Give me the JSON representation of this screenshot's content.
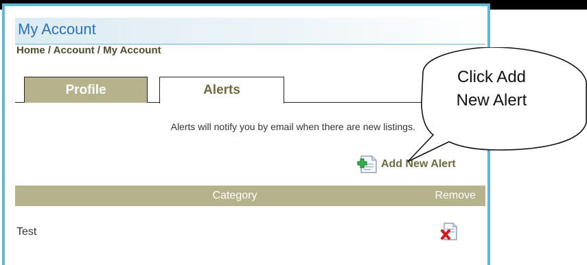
{
  "page": {
    "title": "My Account",
    "breadcrumb": [
      "Home",
      "Account",
      "My Account"
    ],
    "breadcrumb_sep": " / "
  },
  "tabs": [
    {
      "label": "Profile",
      "active": false
    },
    {
      "label": "Alerts",
      "active": true
    }
  ],
  "alerts": {
    "info": "Alerts will notify you by email when there are new listings.",
    "add_label": "Add New Alert",
    "columns": {
      "category": "Category",
      "remove": "Remove"
    },
    "rows": [
      {
        "category": "Test"
      }
    ]
  },
  "callout": {
    "line1": "Click Add",
    "line2": "New Alert"
  },
  "colors": {
    "accent": "#5fb8d6",
    "tab_olive": "#b5b28c",
    "title_blue": "#2a72b8",
    "olive_text": "#6f6a3e"
  },
  "icons": {
    "add": "add-document-icon",
    "remove": "remove-document-icon"
  }
}
